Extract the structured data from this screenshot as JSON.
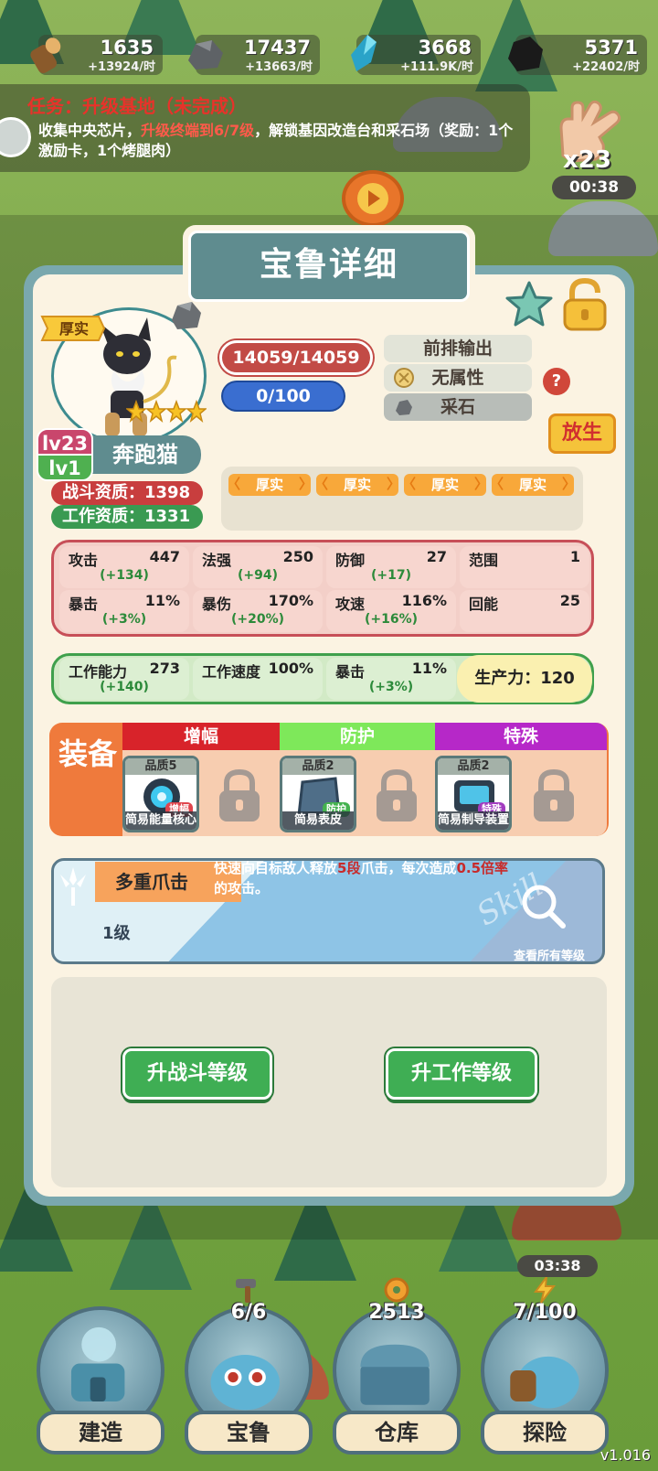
{
  "resources": [
    {
      "icon": "wood-log-icon",
      "amount": "1635",
      "rate": "+13924/时"
    },
    {
      "icon": "stone-icon",
      "amount": "17437",
      "rate": "+13663/时"
    },
    {
      "icon": "crystal-icon",
      "amount": "3668",
      "rate": "+111.9K/时"
    },
    {
      "icon": "coal-icon",
      "amount": "5371",
      "rate": "+22402/时"
    }
  ],
  "task": {
    "title": "任务：升级基地（未完成）",
    "desc_a": "收集中央芯片，",
    "desc_hl": "升级终端到6/7级",
    "desc_b": "，解锁基因改造台和采石场（奖励：1个激励卡，1个烤腿肉）"
  },
  "glove": {
    "count": "x23",
    "timer": "00:38"
  },
  "panel": {
    "title": "宝鲁详细",
    "trait_badge": "厚实",
    "level_battle": "lv23",
    "level_work": "lv1",
    "name": "奔跑猫",
    "battle_aptitude": "战斗资质：1398",
    "work_aptitude": "工作资质：1331",
    "hp": "14059/14059",
    "mp": "0/100",
    "roles": [
      "前排输出",
      "无属性",
      "采石"
    ],
    "help": "?",
    "release": "放生",
    "traits": [
      "厚实",
      "厚实",
      "厚实",
      "厚实"
    ],
    "stars": 4
  },
  "stats": [
    {
      "label": "攻击",
      "value": "447",
      "bonus": "(+134)"
    },
    {
      "label": "法强",
      "value": "250",
      "bonus": "(+94)"
    },
    {
      "label": "防御",
      "value": "27",
      "bonus": "(+17)"
    },
    {
      "label": "范围",
      "value": "1",
      "bonus": ""
    },
    {
      "label": "暴击",
      "value": "11%",
      "bonus": "(+3%)"
    },
    {
      "label": "暴伤",
      "value": "170%",
      "bonus": "(+20%)"
    },
    {
      "label": "攻速",
      "value": "116%",
      "bonus": "(+16%)"
    },
    {
      "label": "回能",
      "value": "25",
      "bonus": ""
    }
  ],
  "work_stats": [
    {
      "label": "工作能力",
      "value": "273",
      "bonus": "(+140)"
    },
    {
      "label": "工作速度",
      "value": "100%",
      "bonus": ""
    },
    {
      "label": "暴击",
      "value": "11%",
      "bonus": "(+3%)"
    }
  ],
  "productivity": "生产力：120",
  "equipment": {
    "title": "装备",
    "columns": [
      {
        "name": "增幅",
        "color": "#d8232a",
        "item": {
          "quality": "品质5",
          "tag": "增幅",
          "tag_color": "#e0454d",
          "name": "简易能量核心"
        }
      },
      {
        "name": "防护",
        "color": "#7ee85a",
        "item": {
          "quality": "品质2",
          "tag": "防护",
          "tag_color": "#44b24f",
          "name": "简易表皮"
        }
      },
      {
        "name": "特殊",
        "color": "#b628c8",
        "item": {
          "quality": "品质2",
          "tag": "特殊",
          "tag_color": "#a23cc0",
          "name": "简易制导装置"
        }
      }
    ]
  },
  "skill": {
    "name": "多重爪击",
    "level": "1级",
    "desc_a": "快速向目标敌人释放",
    "desc_hl": "5段",
    "desc_b": "爪击，每次造成",
    "desc_hl2": "0.5倍率",
    "desc_c": "的攻击。",
    "watermark": "Skill",
    "view_all": "查看所有等级"
  },
  "buttons": {
    "upgrade_battle": "升战斗等级",
    "upgrade_work": "升工作等级"
  },
  "nav": [
    {
      "label": "建造",
      "count": ""
    },
    {
      "label": "宝鲁",
      "count": "6/6"
    },
    {
      "label": "仓库",
      "count": "2513"
    },
    {
      "label": "探险",
      "count": "7/100"
    }
  ],
  "nav_timer": "03:38",
  "version": "v1.016"
}
